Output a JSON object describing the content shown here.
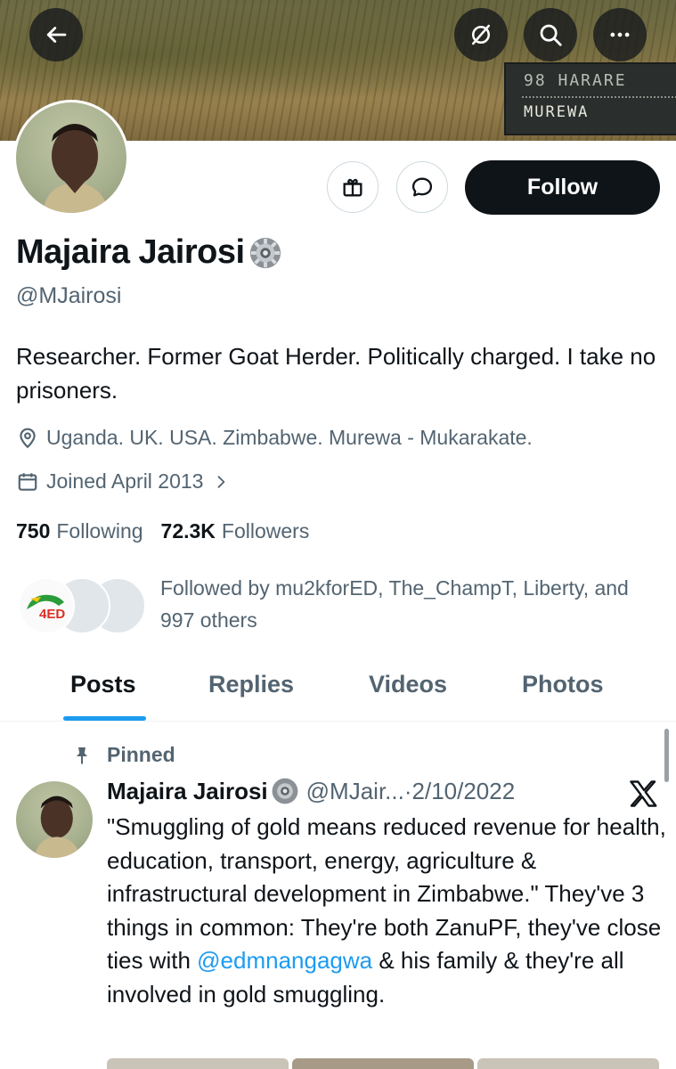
{
  "banner": {
    "sign_line1": "98 HARARE",
    "sign_line2": "MUREWA"
  },
  "profile": {
    "display_name": "Majaira Jairosi",
    "handle": "@MJairosi",
    "bio": "Researcher. Former Goat Herder. Politically charged. I take no prisoners.",
    "location": "Uganda. UK. USA. Zimbabwe. Murewa - Mukarakate.",
    "joined": "Joined April 2013",
    "following_count": "750",
    "following_label": "Following",
    "followers_count": "72.3K",
    "followers_label": "Followers",
    "followed_by_text": "Followed by mu2kforED, The_ChampT, Liberty, and 997 others",
    "follow_button_label": "Follow",
    "follower_avatar_logo_text": "4ED"
  },
  "tabs": [
    {
      "label": "Posts",
      "active": true
    },
    {
      "label": "Replies",
      "active": false
    },
    {
      "label": "Videos",
      "active": false
    },
    {
      "label": "Photos",
      "active": false
    }
  ],
  "tweet": {
    "pinned_label": "Pinned",
    "author_name": "Majaira Jairosi",
    "author_handle": "@MJair...",
    "separator": "·",
    "date": "2/10/2022",
    "text_part1": "\"Smuggling of gold means reduced revenue for health, education, transport, energy, agriculture & infrastructural development in Zimbabwe.\" They've 3 things in common: They're both ZanuPF, they've close ties with ",
    "mention": "@edmnangagwa",
    "text_part2": " & his family & they're all involved in gold smuggling."
  },
  "icons": {
    "back": "back-arrow-icon",
    "grok": "grok-icon",
    "search": "search-icon",
    "more": "more-icon",
    "gift": "gift-icon",
    "message": "message-icon",
    "location": "location-pin-icon",
    "calendar": "calendar-icon",
    "pin": "pin-icon",
    "verified": "gear-badge-icon",
    "x": "x-logo-icon"
  },
  "colors": {
    "accent": "#1d9bf0",
    "text_primary": "#0f1419",
    "text_secondary": "#536471",
    "follow_button": "#0f1419"
  }
}
